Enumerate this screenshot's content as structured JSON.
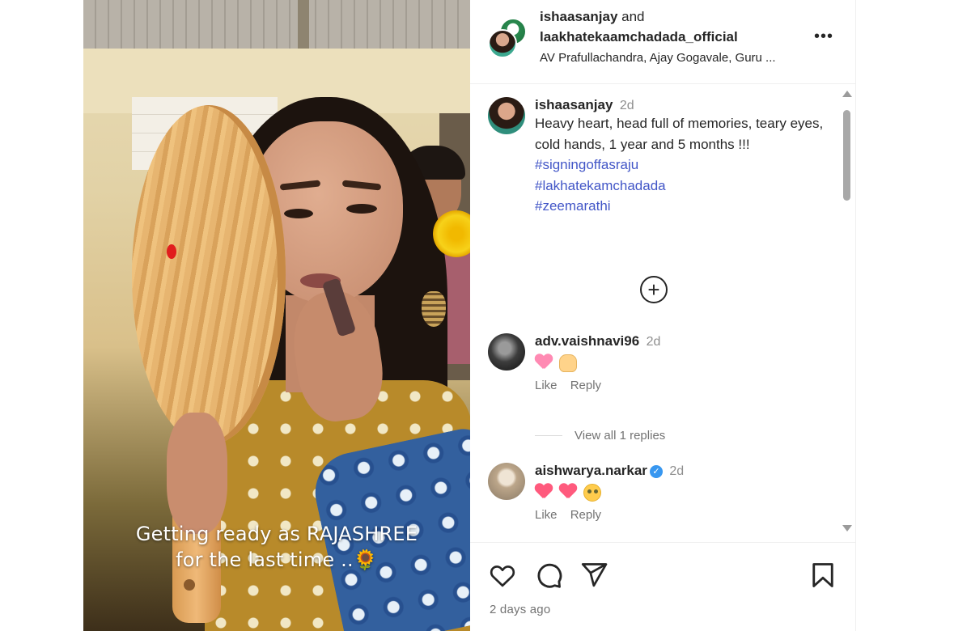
{
  "media": {
    "caption_line1": "Getting ready as RAJASHREE",
    "caption_line2": "for the last time ..🌻"
  },
  "header": {
    "user1": "ishaasanjay",
    "and_text": " and",
    "user2": "laakhatekaamchadada_official",
    "audio": "AV Prafullachandra, Ajay Gogavale, Guru ..."
  },
  "post_caption": {
    "username": "ishaasanjay",
    "time": "2d",
    "text": "Heavy heart, head full of memories, teary eyes, cold hands, 1 year and 5 months !!!",
    "hashtags": [
      "#signingoffasraju",
      "#lakhatekamchadada",
      "#zeemarathi"
    ]
  },
  "comments": [
    {
      "username": "adv.vaishnavi96",
      "time": "2d",
      "emojis": [
        "pink-heart",
        "praying-hands"
      ],
      "like_label": "Like",
      "reply_label": "Reply",
      "view_replies": "View all 1 replies"
    },
    {
      "username": "aishwarya.narkar",
      "verified": true,
      "time": "2d",
      "emojis": [
        "red-heart",
        "red-heart",
        "star-struck-face"
      ],
      "like_label": "Like",
      "reply_label": "Reply"
    }
  ],
  "footer": {
    "timestamp": "2 days ago"
  },
  "colors": {
    "hashtag": "#4256c7",
    "secondary_text": "#737373",
    "verified": "#3897f0"
  }
}
